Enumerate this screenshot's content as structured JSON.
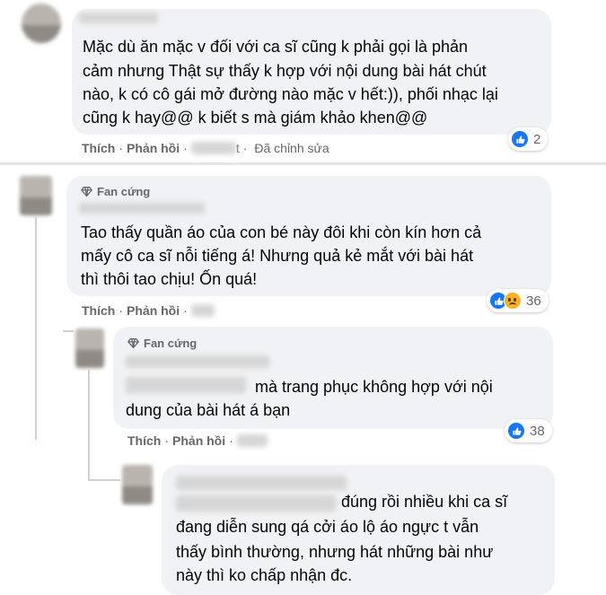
{
  "comments": [
    {
      "badge": "",
      "lines": [
        "Mặc dù ăn mặc v đối với ca sĩ cũng k phải gọi là phản",
        "cảm nhưng Thật sự thấy k hợp với nội dung bài hát chút",
        "nào, k có cô gái mở đường nào mặc v hết:)), phối nhạc lại",
        "cũng k hay@@ k biết s mà giám khảo khen@@"
      ],
      "like_label": "Thích",
      "reply_label": "Phản hồi",
      "time": "t",
      "edited": "Đã chỉnh sửa",
      "reaction_count": "2"
    },
    {
      "badge": "Fan cứng",
      "lines": [
        "Tao thấy quần áo của con bé này đôi khi còn kín hơn cả",
        "mấy cô ca sĩ nỗi tiếng á! Nhưng quả kẻ mắt với bài hát",
        "thì thôi tao chịu! Ốn quá!"
      ],
      "like_label": "Thích",
      "reply_label": "Phản hồi",
      "reaction_count": "36"
    },
    {
      "badge": "Fan cứng",
      "lines": [
        "mà trang phục không hợp với nội",
        "dung của bài hát á bạn"
      ],
      "like_label": "Thích",
      "reply_label": "Phản hồi",
      "reaction_count": "38"
    },
    {
      "badge": "",
      "lines": [
        "đúng rồi nhiều khi ca sĩ",
        "đang diễn sung qá cởi áo lộ áo ngực t vẫn",
        "thấy bình thường, nhưng hát những bài như",
        "này thì ko chấp nhận đc."
      ]
    }
  ],
  "colors": {
    "bubble": "#f0f2f5",
    "text": "#050505",
    "meta": "#65676b",
    "like_blue": "#1877f2",
    "sad_yellow": "#f7b125"
  },
  "icons": [
    "diamond-icon",
    "like-icon",
    "sad-icon"
  ]
}
